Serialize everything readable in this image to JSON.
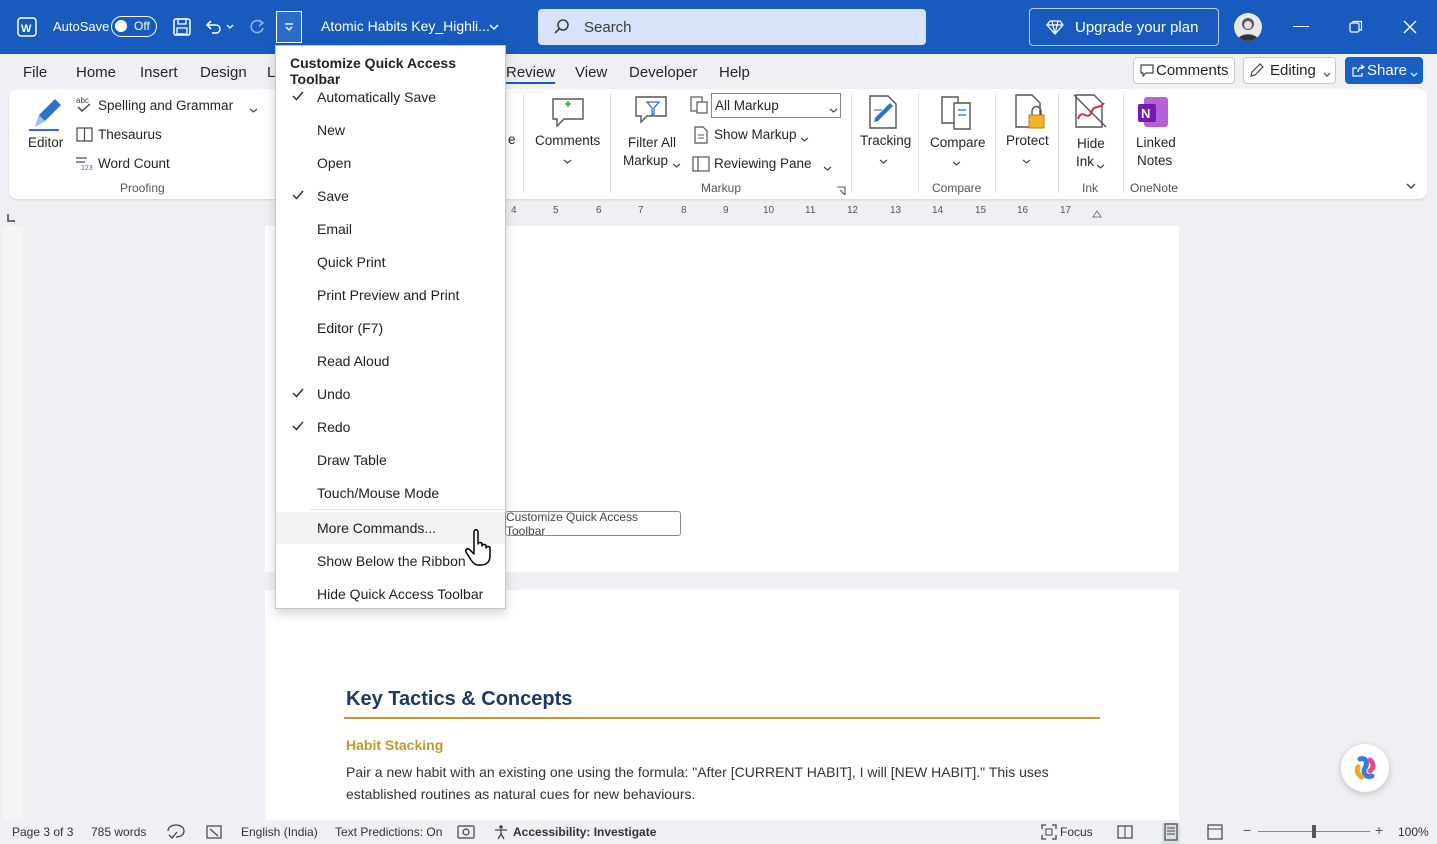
{
  "titlebar": {
    "autosave_label": "AutoSave",
    "autosave_state": "Off",
    "doc_title": "Atomic Habits Key_Highli...",
    "search_placeholder": "Search",
    "upgrade_label": "Upgrade your plan"
  },
  "tabs": [
    "File",
    "Home",
    "Insert",
    "Design",
    "L",
    "Review",
    "View",
    "Developer",
    "Help"
  ],
  "right_controls": {
    "comments": "Comments",
    "editing": "Editing",
    "share": "Share"
  },
  "ribbon": {
    "editor": "Editor",
    "spelling": "Spelling and Grammar",
    "thesaurus": "Thesaurus",
    "word_count": "Word Count",
    "proofing_group": "Proofing",
    "partial_label": "e",
    "comments": "Comments",
    "filter_all_1": "Filter All",
    "filter_all_2": "Markup",
    "all_markup": "All Markup",
    "show_markup": "Show Markup",
    "reviewing_pane": "Reviewing Pane",
    "markup_group": "Markup",
    "tracking": "Tracking",
    "compare": "Compare",
    "compare_group": "Compare",
    "protect": "Protect",
    "hide_ink_1": "Hide",
    "hide_ink_2": "Ink",
    "ink_group": "Ink",
    "linked_1": "Linked",
    "linked_2": "Notes",
    "onenote_group": "OneNote"
  },
  "ruler": [
    "4",
    "5",
    "6",
    "7",
    "8",
    "9",
    "10",
    "11",
    "12",
    "13",
    "14",
    "15",
    "16",
    "17"
  ],
  "menu": {
    "title": "Customize Quick Access Toolbar",
    "items": [
      {
        "label": "Automatically Save",
        "checked": true
      },
      {
        "label": "New",
        "checked": false
      },
      {
        "label": "Open",
        "checked": false
      },
      {
        "label": "Save",
        "checked": true
      },
      {
        "label": "Email",
        "checked": false
      },
      {
        "label": "Quick Print",
        "checked": false
      },
      {
        "label": "Print Preview and Print",
        "checked": false
      },
      {
        "label": "Editor (F7)",
        "checked": false
      },
      {
        "label": "Read Aloud",
        "checked": false
      },
      {
        "label": "Undo",
        "checked": true
      },
      {
        "label": "Redo",
        "checked": true
      },
      {
        "label": "Draw Table",
        "checked": false
      },
      {
        "label": "Touch/Mouse Mode",
        "checked": false
      }
    ],
    "more_commands": "More Commands...",
    "show_below": "Show Below the Ribbon",
    "hide_qat": "Hide Quick Access Toolbar"
  },
  "tooltip": "Customize Quick Access Toolbar",
  "document": {
    "heading": "Key Tactics & Concepts",
    "subheading": "Habit Stacking",
    "body_line1": "Pair a new habit with an existing one using the formula: \"After [CURRENT HABIT], I will [NEW HABIT].\" This uses",
    "body_line2": "established routines as natural cues for new behaviours."
  },
  "status": {
    "page": "Page 3 of 3",
    "words": "785 words",
    "language": "English (India)",
    "predictions": "Text Predictions: On",
    "accessibility": "Accessibility: Investigate",
    "focus": "Focus",
    "zoom": "100%"
  }
}
